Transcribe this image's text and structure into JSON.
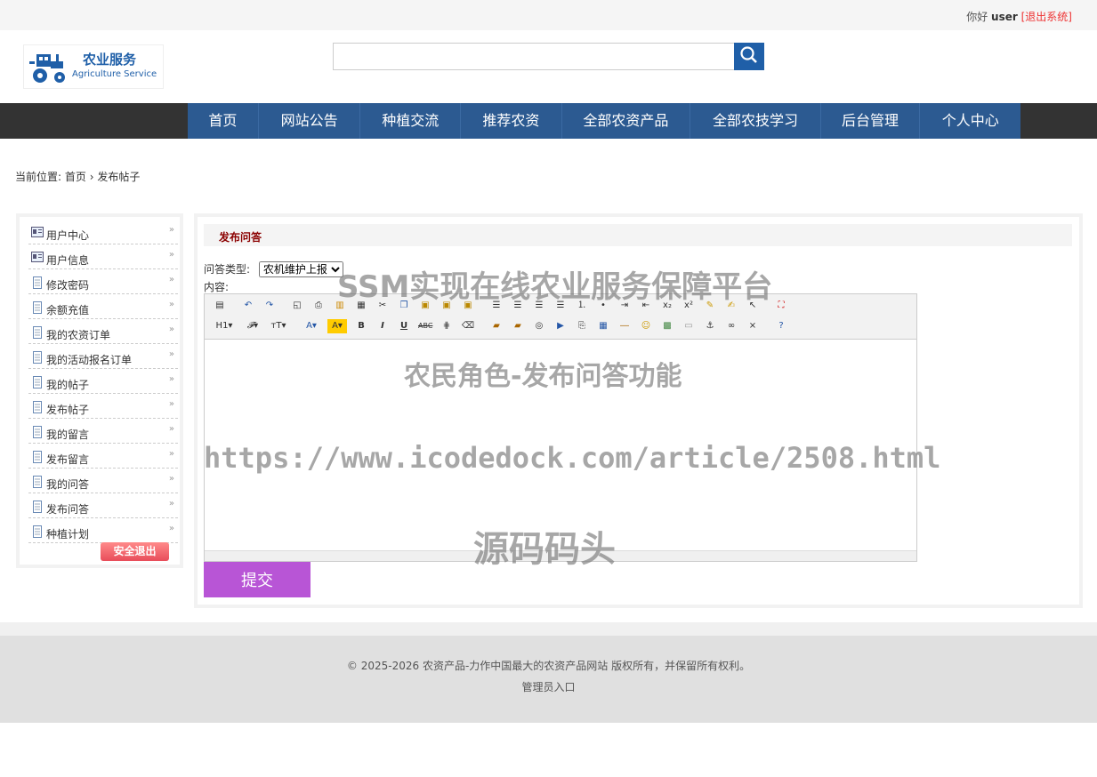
{
  "topbar": {
    "greeting": "你好",
    "username": "user",
    "logout": "[退出系统]"
  },
  "logo": {
    "cn": "农业服务",
    "en": "Agriculture Service"
  },
  "search": {
    "placeholder": "",
    "icon": "search-icon"
  },
  "nav": {
    "items": [
      "首页",
      "网站公告",
      "种植交流",
      "推荐农资",
      "全部农资产品",
      "全部农技学习",
      "后台管理",
      "个人中心"
    ]
  },
  "breadcrumb": {
    "prefix": "当前位置:",
    "home": "首页",
    "sep": "›",
    "current": "发布帖子"
  },
  "sidebar": {
    "items": [
      "用户中心",
      "用户信息",
      "修改密码",
      "余额充值",
      "我的农资订单",
      "我的活动报名订单",
      "我的帖子",
      "发布帖子",
      "我的留言",
      "发布留言",
      "我的问答",
      "发布问答",
      "种植计划"
    ],
    "exit_label": "安全退出"
  },
  "main": {
    "title": "发布问答",
    "type_label": "问答类型:",
    "type_selected": "农机维护上报",
    "content_label": "内容:",
    "submit_label": "提交"
  },
  "watermarks": {
    "w1": "SSM实现在线农业服务保障平台",
    "w2": "农民角色-发布问答功能",
    "w3": "https://www.icodedock.com/article/2508.html",
    "w4": "源码码头"
  },
  "footer": {
    "copyright": "© 2025-2026 农资产品-力作中国最大的农资产品网站 版权所有，并保留所有权利。",
    "admin": "管理员入口"
  },
  "colors": {
    "nav_bg": "#2c5a91",
    "submit_bg": "#b855d6",
    "title_text": "#8b0000"
  }
}
